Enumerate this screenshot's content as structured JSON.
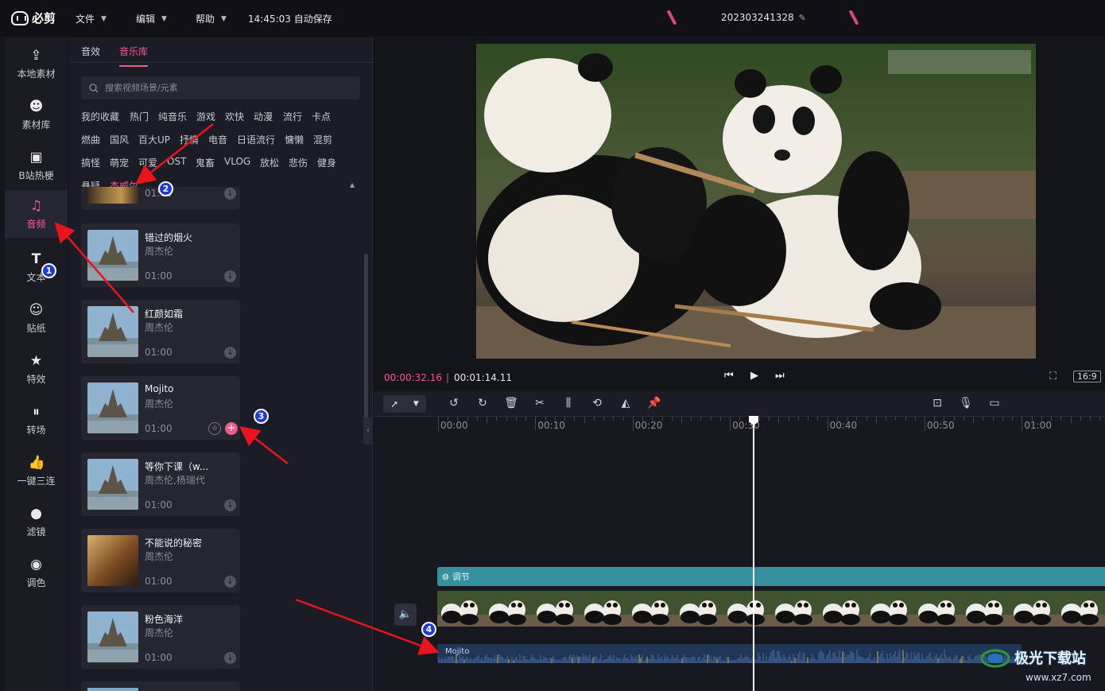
{
  "app": {
    "name": "必剪",
    "menus": [
      "文件",
      "编辑",
      "帮助"
    ],
    "autosave": "14:45:03 自动保存",
    "project_name": "202303241328"
  },
  "sidebar": {
    "items": [
      {
        "label": "本地素材",
        "icon": "upload-icon"
      },
      {
        "label": "素材库",
        "icon": "material-icon"
      },
      {
        "label": "B站热梗",
        "icon": "tv-icon"
      },
      {
        "label": "音频",
        "icon": "music-note-icon"
      },
      {
        "label": "文本",
        "icon": "text-icon"
      },
      {
        "label": "贴纸",
        "icon": "sticker-icon"
      },
      {
        "label": "特效",
        "icon": "effect-icon"
      },
      {
        "label": "转场",
        "icon": "transition-icon"
      },
      {
        "label": "一键三连",
        "icon": "thumbs-up-icon"
      },
      {
        "label": "滤镜",
        "icon": "filter-icon"
      },
      {
        "label": "调色",
        "icon": "palette-icon"
      }
    ],
    "active": "音频"
  },
  "music_panel": {
    "tabs": [
      "音效",
      "音乐库"
    ],
    "active_tab": "音乐库",
    "search_placeholder": "搜索视频场景/元素",
    "categories": [
      [
        "我的收藏",
        "热门",
        "纯音乐",
        "游戏",
        "欢快",
        "动漫",
        "流行",
        "卡点"
      ],
      [
        "燃曲",
        "国风",
        "百大UP",
        "抒情",
        "电音",
        "日语流行",
        "慵懒",
        "混剪"
      ],
      [
        "搞怪",
        "萌宠",
        "可爱",
        "OST",
        "鬼畜",
        "VLOG",
        "放松",
        "悲伤",
        "健身"
      ],
      [
        "悬疑",
        "杰威尔"
      ]
    ],
    "selected_category": "杰威尔",
    "partial_song_duration": "01:00",
    "songs": [
      {
        "title": "错过的烟火",
        "artist": "周杰伦",
        "duration": "01:00"
      },
      {
        "title": "红颜如霜",
        "artist": "周杰伦",
        "duration": "01:00"
      },
      {
        "title": "Mojito",
        "artist": "周杰伦",
        "duration": "01:00"
      },
      {
        "title": "等你下课（w...",
        "artist": "周杰伦,杨瑞代",
        "duration": "01:00"
      },
      {
        "title": "不能说的秘密",
        "artist": "周杰伦",
        "duration": "01:00"
      },
      {
        "title": "粉色海洋",
        "artist": "周杰伦",
        "duration": "01:00"
      }
    ]
  },
  "player": {
    "current_time": "00:00:32.16",
    "total_time": "00:01:14.11",
    "aspect_ratio": "16:9"
  },
  "timeline": {
    "ruler_labels": [
      "00:00",
      "00:10",
      "00:20",
      "00:30",
      "00:40",
      "00:50",
      "01:00"
    ],
    "adjust_track_label": "调节",
    "audio_clip_label": "Mojito"
  },
  "annotations": [
    "1",
    "2",
    "3",
    "4"
  ],
  "watermark": {
    "text": "极光下载站",
    "url": "www.xz7.com"
  },
  "colors": {
    "accent": "#f05b8d",
    "adjust_track": "#36909e",
    "audio_track": "#203656",
    "annotation": "#1d3ad9",
    "arrow": "#e8141e"
  }
}
